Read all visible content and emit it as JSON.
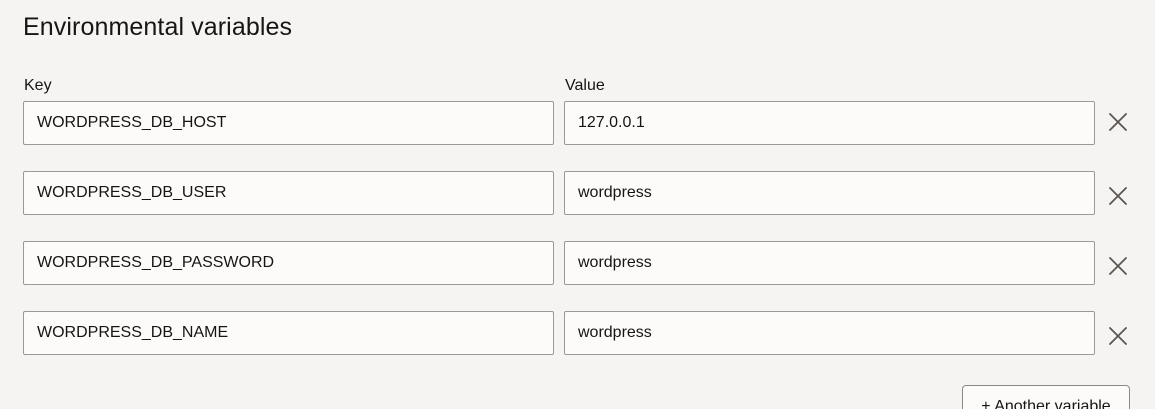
{
  "section": {
    "title": "Environmental variables",
    "key_label": "Key",
    "value_label": "Value"
  },
  "variables": [
    {
      "key": "WORDPRESS_DB_HOST",
      "value": "127.0.0.1"
    },
    {
      "key": "WORDPRESS_DB_USER",
      "value": "wordpress"
    },
    {
      "key": "WORDPRESS_DB_PASSWORD",
      "value": "wordpress"
    },
    {
      "key": "WORDPRESS_DB_NAME",
      "value": "wordpress"
    }
  ],
  "actions": {
    "remove_icon": "close-icon",
    "add_label": "+ Another variable"
  },
  "colors": {
    "background": "#f5f4f2",
    "field_background": "#fcfbfa",
    "field_border": "#9e9892",
    "text": "#161513",
    "icon": "#5b5652"
  }
}
